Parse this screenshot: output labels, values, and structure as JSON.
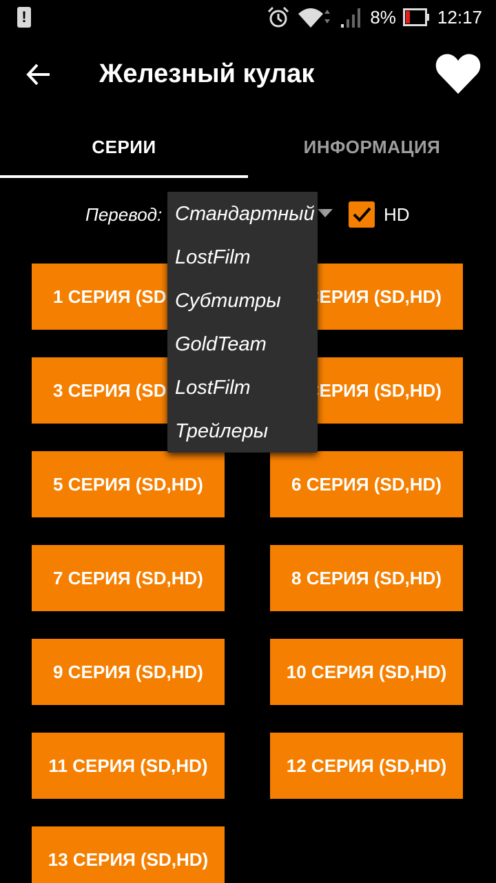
{
  "status_bar": {
    "battery_percent": "8%",
    "time": "12:17",
    "icons": [
      "alert-icon",
      "alarm-icon",
      "wifi-icon",
      "signal-icon",
      "battery-icon"
    ]
  },
  "app_bar": {
    "title": "Железный кулак",
    "back_icon": "arrow-back-icon",
    "favorite_icon": "heart-icon"
  },
  "tabs": [
    {
      "label": "СЕРИИ",
      "active": true
    },
    {
      "label": "ИНФОРМАЦИЯ",
      "active": false
    }
  ],
  "translation": {
    "label": "Перевод:",
    "selected": "Стандартный",
    "options": [
      "Стандартный",
      "LostFilm",
      "Субтитры",
      "GoldTeam",
      "LostFilm",
      "Трейлеры"
    ],
    "hd_checked": true,
    "hd_label": "HD"
  },
  "episodes": [
    "1 СЕРИЯ (SD,HD)",
    "2 СЕРИЯ (SD,HD)",
    "3 СЕРИЯ (SD,HD)",
    "4 СЕРИЯ (SD,HD)",
    "5 СЕРИЯ (SD,HD)",
    "6 СЕРИЯ (SD,HD)",
    "7 СЕРИЯ (SD,HD)",
    "8 СЕРИЯ (SD,HD)",
    "9 СЕРИЯ (SD,HD)",
    "10 СЕРИЯ (SD,HD)",
    "11 СЕРИЯ (SD,HD)",
    "12 СЕРИЯ (SD,HD)",
    "13 СЕРИЯ (SD,HD)"
  ],
  "colors": {
    "accent": "#f57f00",
    "background": "#000000",
    "dropdown_bg": "#2f2f2f",
    "inactive_tab": "#9e9e9e"
  }
}
